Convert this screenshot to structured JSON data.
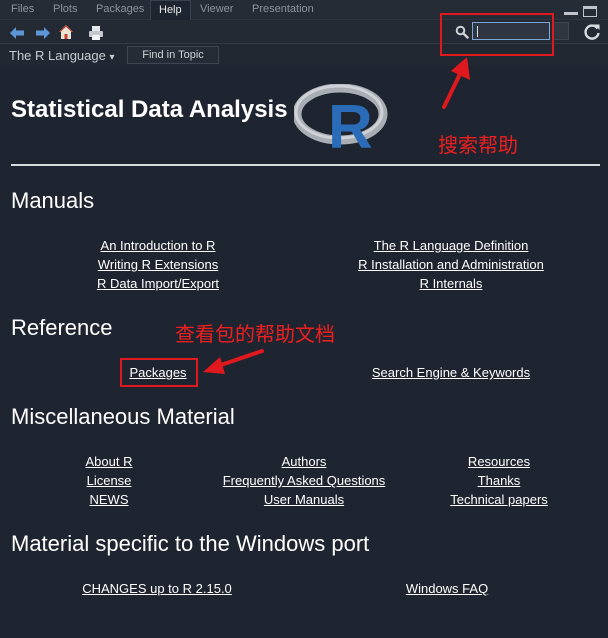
{
  "tabs": [
    {
      "label": "Files",
      "active": false
    },
    {
      "label": "Plots",
      "active": false
    },
    {
      "label": "Packages",
      "active": false
    },
    {
      "label": "Help",
      "active": true
    },
    {
      "label": "Viewer",
      "active": false
    },
    {
      "label": "Presentation",
      "active": false
    }
  ],
  "toolbar": {
    "icons": [
      "back-arrow-icon",
      "forward-arrow-icon",
      "home-icon",
      "print-icon",
      "search-icon",
      "refresh-icon"
    ],
    "search_value": ""
  },
  "subbar": {
    "topic_label": "The R Language",
    "topic_arrow": "▾",
    "find_button": "Find in Topic"
  },
  "page": {
    "title": "Statistical Data Analysis",
    "logo": "R",
    "sections": {
      "manuals": {
        "heading": "Manuals",
        "links": [
          "An Introduction to R",
          "The R Language Definition",
          "Writing R Extensions",
          "R Installation and Administration",
          "R Data Import/Export",
          "R Internals"
        ]
      },
      "reference": {
        "heading": "Reference",
        "links": [
          "Packages",
          "Search Engine & Keywords"
        ]
      },
      "misc": {
        "heading": "Miscellaneous Material",
        "links": [
          "About R",
          "Authors",
          "Resources",
          "License",
          "Frequently Asked Questions",
          "Thanks",
          "NEWS",
          "User Manuals",
          "Technical papers"
        ]
      },
      "windows": {
        "heading": "Material specific to the Windows port",
        "links": [
          "CHANGES up to R 2.15.0",
          "Windows FAQ"
        ]
      }
    }
  },
  "annotations": {
    "search_help": "搜索帮助",
    "package_help": "查看包的帮助文档",
    "color": "#e0191e"
  },
  "colors": {
    "background": "#1f2530",
    "toolbar": "#242a34",
    "search_border": "#7ea8d8",
    "logo_ring": "#b8bcc2",
    "logo_letter": "#2b6cb8"
  }
}
